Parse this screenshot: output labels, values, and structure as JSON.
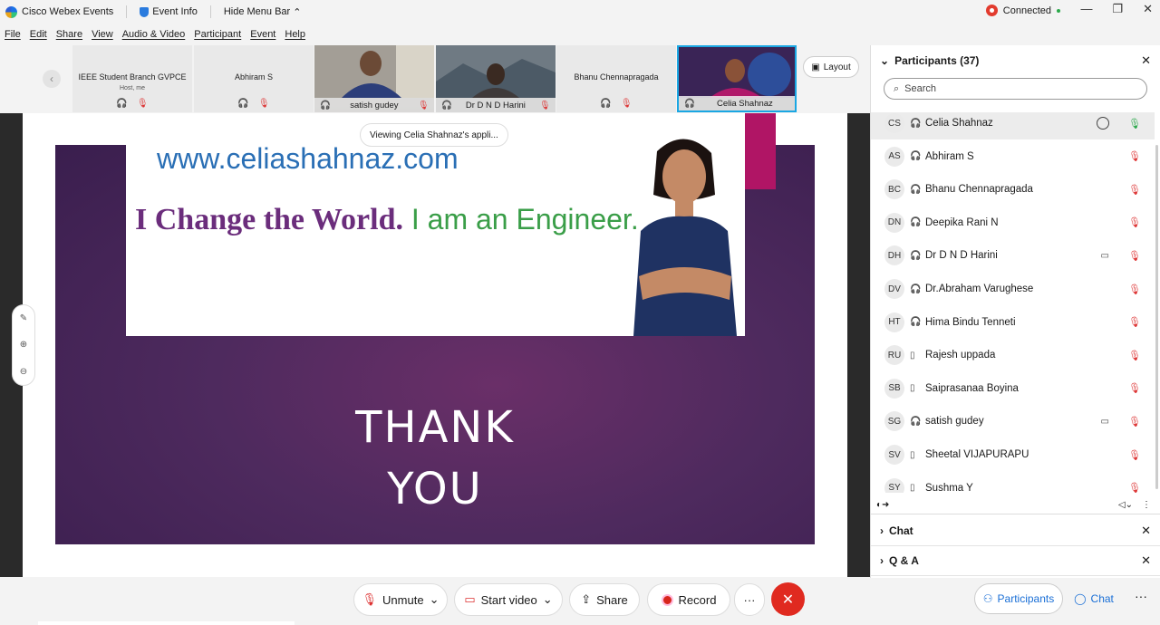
{
  "titlebar": {
    "app_name": "Cisco Webex Events",
    "event_info": "Event Info",
    "hide_menu": "Hide Menu Bar",
    "connection": "Connected"
  },
  "menu": [
    "File",
    "Edit",
    "Share",
    "View",
    "Audio & Video",
    "Participant",
    "Event",
    "Help"
  ],
  "strip": {
    "tiles": [
      {
        "name": "IEEE Student Branch GVPCE",
        "sub": "Host, me"
      },
      {
        "name": "Abhiram S"
      },
      {
        "name": "satish gudey"
      },
      {
        "name": "Dr D N D Harini"
      },
      {
        "name": "Bhanu Chennapragada"
      },
      {
        "name": "Celia Shahnaz"
      }
    ],
    "layout_label": "Layout"
  },
  "stage": {
    "viewing": "Viewing Celia Shahnaz's appli...",
    "url": "www.celiashahnaz.com",
    "tagline_a": "I Change the World.",
    "tagline_b": " I am an Engineer.",
    "thank_line1": "THANK",
    "thank_line2": "YOU"
  },
  "panel": {
    "participants_title": "Participants (37)",
    "search_placeholder": "Search",
    "partial_top": "Host, me",
    "participants": [
      {
        "initials": "CS",
        "name": "Celia Shahnaz",
        "device": "headset",
        "video": false,
        "mic": "on"
      },
      {
        "initials": "AS",
        "name": "Abhiram S",
        "device": "headset",
        "video": false,
        "mic": "off"
      },
      {
        "initials": "BC",
        "name": "Bhanu Chennapragada",
        "device": "headset",
        "video": false,
        "mic": "off"
      },
      {
        "initials": "DN",
        "name": "Deepika Rani N",
        "device": "headset",
        "video": false,
        "mic": "off"
      },
      {
        "initials": "DH",
        "name": "Dr D N D Harini",
        "device": "headset",
        "video": true,
        "mic": "off"
      },
      {
        "initials": "DV",
        "name": "Dr.Abraham Varughese",
        "device": "headset",
        "video": false,
        "mic": "off"
      },
      {
        "initials": "HT",
        "name": "Hima Bindu Tenneti",
        "device": "headset",
        "video": false,
        "mic": "off"
      },
      {
        "initials": "RU",
        "name": "Rajesh uppada",
        "device": "phone",
        "video": false,
        "mic": "off"
      },
      {
        "initials": "SB",
        "name": "Saiprasanaa Boyina",
        "device": "phone",
        "video": false,
        "mic": "off"
      },
      {
        "initials": "SG",
        "name": "satish gudey",
        "device": "headset",
        "video": true,
        "mic": "off"
      },
      {
        "initials": "SV",
        "name": "Sheetal VIJAPURAPU",
        "device": "phone",
        "video": false,
        "mic": "off"
      },
      {
        "initials": "SY",
        "name": "Sushma Y",
        "device": "phone",
        "video": false,
        "mic": "off"
      }
    ],
    "chat_title": "Chat",
    "qa_title": "Q & A"
  },
  "controls": {
    "unmute": "Unmute",
    "start_video": "Start video",
    "share": "Share",
    "record": "Record",
    "participants": "Participants",
    "chat": "Chat"
  },
  "colors": {
    "accent": "#1a6fd6",
    "end_call": "#e02a20",
    "muted": "#dd3333",
    "slide_purple": "#4e2a5e"
  }
}
